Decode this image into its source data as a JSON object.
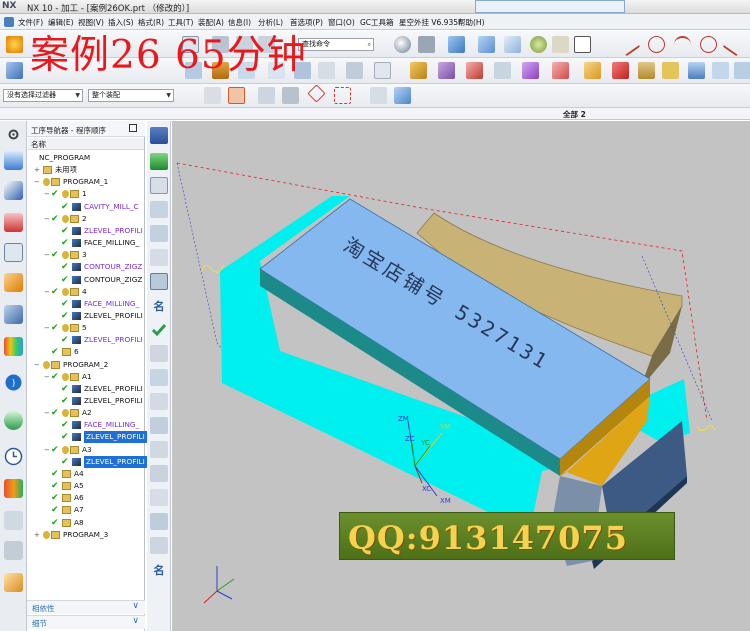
{
  "window": {
    "logo": "NX",
    "title": "NX 10 - 加工 - [案例26OK.prt （修改的）]"
  },
  "menu": {
    "items": [
      "文件(F)",
      "编辑(E)",
      "视图(V)",
      "插入(S)",
      "格式(R)",
      "工具(T)",
      "装配(A)",
      "信息(I)",
      "分析(L)",
      "首选项(P)",
      "窗口(O)",
      "GC工具箱",
      "星空外挂 V6.935F",
      "帮助(H)"
    ]
  },
  "overlay": {
    "banner": "案例26   65分钟",
    "qq": "QQ:913147075"
  },
  "toolbar": {
    "find_placeholder": "查找命令",
    "selection_filter": "没有选择过滤器",
    "assembly_scope": "整个装配"
  },
  "section_header": {
    "label": "全部 2"
  },
  "navigator": {
    "title": "工序导航器 - 程序顺序",
    "column": "名称",
    "rows": [
      {
        "label": "NC_PROGRAM",
        "level": 0,
        "expander": "",
        "check": false,
        "icon": "none"
      },
      {
        "label": "未用项",
        "level": 1,
        "expander": "+",
        "check": false,
        "icon": "folder"
      },
      {
        "label": "PROGRAM_1",
        "level": 1,
        "expander": "−",
        "check": false,
        "icon": "key-folder"
      },
      {
        "label": "1",
        "level": 2,
        "expander": "−",
        "check": true,
        "icon": "key-folder"
      },
      {
        "label": "CAVITY_MILL_C",
        "level": 3,
        "expander": "",
        "check": true,
        "icon": "op",
        "purple": true
      },
      {
        "label": "2",
        "level": 2,
        "expander": "−",
        "check": true,
        "icon": "key-folder"
      },
      {
        "label": "ZLEVEL_PROFILI",
        "level": 3,
        "expander": "",
        "check": true,
        "icon": "op",
        "purple": true
      },
      {
        "label": "FACE_MILLING_",
        "level": 3,
        "expander": "",
        "check": true,
        "icon": "op"
      },
      {
        "label": "3",
        "level": 2,
        "expander": "−",
        "check": true,
        "icon": "key-folder"
      },
      {
        "label": "CONTOUR_ZIGZ",
        "level": 3,
        "expander": "",
        "check": true,
        "icon": "op",
        "purple": true
      },
      {
        "label": "CONTOUR_ZIGZ",
        "level": 3,
        "expander": "",
        "check": true,
        "icon": "op"
      },
      {
        "label": "4",
        "level": 2,
        "expander": "−",
        "check": true,
        "icon": "key-folder"
      },
      {
        "label": "FACE_MILLING_",
        "level": 3,
        "expander": "",
        "check": true,
        "icon": "op",
        "purple": true
      },
      {
        "label": "ZLEVEL_PROFILI",
        "level": 3,
        "expander": "",
        "check": true,
        "icon": "op"
      },
      {
        "label": "5",
        "level": 2,
        "expander": "−",
        "check": true,
        "icon": "key-folder"
      },
      {
        "label": "ZLEVEL_PROFILI",
        "level": 3,
        "expander": "",
        "check": true,
        "icon": "op",
        "purple": true
      },
      {
        "label": "6",
        "level": 2,
        "expander": "",
        "check": true,
        "icon": "folder"
      },
      {
        "label": "PROGRAM_2",
        "level": 1,
        "expander": "−",
        "check": false,
        "icon": "key-folder"
      },
      {
        "label": "A1",
        "level": 2,
        "expander": "−",
        "check": true,
        "icon": "key-folder"
      },
      {
        "label": "ZLEVEL_PROFILI",
        "level": 3,
        "expander": "",
        "check": true,
        "icon": "op"
      },
      {
        "label": "ZLEVEL_PROFILI",
        "level": 3,
        "expander": "",
        "check": true,
        "icon": "op"
      },
      {
        "label": "A2",
        "level": 2,
        "expander": "−",
        "check": true,
        "icon": "key-folder"
      },
      {
        "label": "FACE_MILLING_",
        "level": 3,
        "expander": "",
        "check": true,
        "icon": "op",
        "purple": true
      },
      {
        "label": "ZLEVEL_PROFILI",
        "level": 3,
        "expander": "",
        "check": true,
        "icon": "op",
        "selected": true
      },
      {
        "label": "A3",
        "level": 2,
        "expander": "−",
        "check": true,
        "icon": "key-folder"
      },
      {
        "label": "ZLEVEL_PROFILI",
        "level": 3,
        "expander": "",
        "check": true,
        "icon": "op",
        "selected": true
      },
      {
        "label": "A4",
        "level": 2,
        "expander": "",
        "check": true,
        "icon": "folder"
      },
      {
        "label": "A5",
        "level": 2,
        "expander": "",
        "check": true,
        "icon": "folder"
      },
      {
        "label": "A6",
        "level": 2,
        "expander": "",
        "check": true,
        "icon": "folder"
      },
      {
        "label": "A7",
        "level": 2,
        "expander": "",
        "check": true,
        "icon": "folder"
      },
      {
        "label": "A8",
        "level": 2,
        "expander": "",
        "check": true,
        "icon": "folder"
      },
      {
        "label": "PROGRAM_3",
        "level": 1,
        "expander": "+",
        "check": false,
        "icon": "key-folder"
      }
    ],
    "footer": [
      "相依性",
      "细节"
    ]
  },
  "viewport": {
    "part_engraving": "淘宝店铺号 5327131",
    "axes": {
      "zm": "ZM",
      "zc": "ZC",
      "yc": "YC",
      "ym": "YM",
      "xc": "XC",
      "xm": "XM"
    }
  },
  "colors": {
    "accent": "#1e6fd6",
    "part_top": "#84b8ee",
    "part_side": "#00f0f0",
    "part_curve": "#c3ad6b",
    "viewport_bg": "#c3c3c3"
  }
}
